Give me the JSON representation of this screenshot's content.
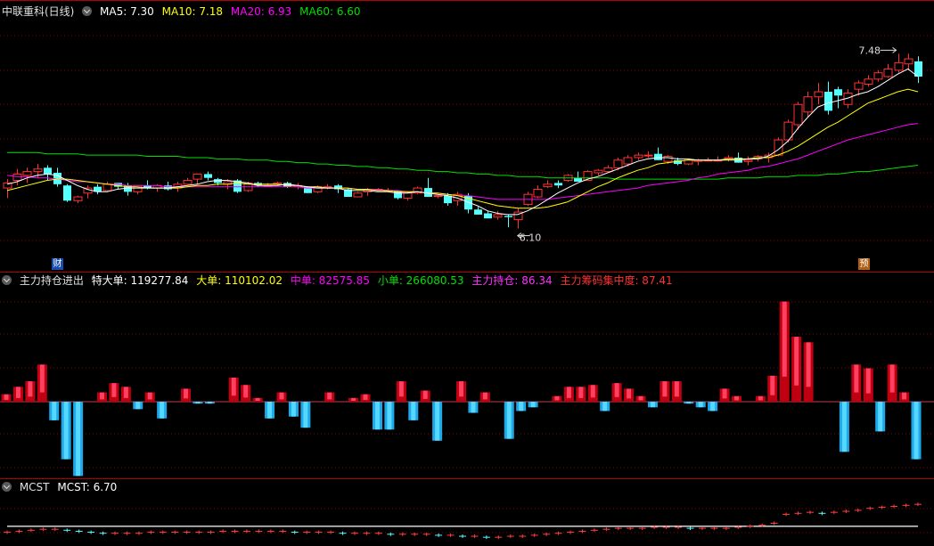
{
  "colors": {
    "up": "#ff3232",
    "down": "#54ffff",
    "ma5": "#ffffff",
    "ma10": "#ffff00",
    "ma20": "#ff00ff",
    "ma60": "#00e000",
    "grid": "#8b0000",
    "border": "#b00000",
    "bigbuy": "#b00000",
    "mcst_up": "#ff4040",
    "mcst_down": "#54ffff"
  },
  "price_panel": {
    "title": "中联重科(日线)",
    "ma5_label": "MA5: 7.30",
    "ma10_label": "MA10: 7.18",
    "ma20_label": "MA20: 6.93",
    "ma60_label": "MA60: 6.60",
    "high_label": "7.48",
    "low_label": "6.10",
    "badge_left": "财",
    "badge_right": "预"
  },
  "flow_panel": {
    "title": "主力持仓进出",
    "l1": "特大单: 119277.84",
    "l2": "大单: 110102.02",
    "l3": "中单: 82575.85",
    "l4": "小单: 266080.53",
    "l5": "主力持仓: 86.34",
    "l6": "主力筹码集中度: 87.41"
  },
  "mcst_panel": {
    "title": "MCST",
    "label": "MCST: 6.70"
  },
  "chart_data": [
    {
      "type": "candlestick",
      "title": "中联重科(日线)",
      "ylim": [
        5.9,
        7.75
      ],
      "annotations": {
        "high": 7.48,
        "low": 6.1
      },
      "ohlc": [
        [
          6.42,
          6.49,
          6.34,
          6.46
        ],
        [
          6.48,
          6.57,
          6.44,
          6.53
        ],
        [
          6.52,
          6.58,
          6.46,
          6.55
        ],
        [
          6.55,
          6.61,
          6.5,
          6.57
        ],
        [
          6.58,
          6.6,
          6.48,
          6.53
        ],
        [
          6.54,
          6.58,
          6.43,
          6.45
        ],
        [
          6.44,
          6.45,
          6.31,
          6.32
        ],
        [
          6.32,
          6.36,
          6.3,
          6.35
        ],
        [
          6.38,
          6.44,
          6.34,
          6.42
        ],
        [
          6.43,
          6.45,
          6.37,
          6.39
        ],
        [
          6.4,
          6.47,
          6.39,
          6.45
        ],
        [
          6.46,
          6.46,
          6.41,
          6.43
        ],
        [
          6.44,
          6.46,
          6.36,
          6.39
        ],
        [
          6.39,
          6.44,
          6.37,
          6.44
        ],
        [
          6.44,
          6.48,
          6.41,
          6.42
        ],
        [
          6.42,
          6.45,
          6.39,
          6.44
        ],
        [
          6.44,
          6.47,
          6.4,
          6.41
        ],
        [
          6.42,
          6.47,
          6.39,
          6.45
        ],
        [
          6.45,
          6.5,
          6.45,
          6.48
        ],
        [
          6.49,
          6.53,
          6.45,
          6.53
        ],
        [
          6.53,
          6.55,
          6.48,
          6.5
        ],
        [
          6.49,
          6.5,
          6.44,
          6.46
        ],
        [
          6.45,
          6.49,
          6.41,
          6.47
        ],
        [
          6.48,
          6.49,
          6.38,
          6.39
        ],
        [
          6.4,
          6.47,
          6.39,
          6.46
        ],
        [
          6.46,
          6.47,
          6.43,
          6.44
        ],
        [
          6.44,
          6.46,
          6.43,
          6.44
        ],
        [
          6.45,
          6.47,
          6.44,
          6.46
        ],
        [
          6.46,
          6.47,
          6.42,
          6.43
        ],
        [
          6.43,
          6.46,
          6.41,
          6.44
        ],
        [
          6.43,
          6.43,
          6.38,
          6.38
        ],
        [
          6.39,
          6.44,
          6.38,
          6.43
        ],
        [
          6.43,
          6.45,
          6.41,
          6.43
        ],
        [
          6.44,
          6.45,
          6.38,
          6.41
        ],
        [
          6.41,
          6.42,
          6.35,
          6.35
        ],
        [
          6.35,
          6.39,
          6.35,
          6.38
        ],
        [
          6.39,
          6.42,
          6.36,
          6.41
        ],
        [
          6.41,
          6.42,
          6.4,
          6.41
        ],
        [
          6.4,
          6.42,
          6.39,
          6.4
        ],
        [
          6.4,
          6.4,
          6.33,
          6.34
        ],
        [
          6.34,
          6.39,
          6.32,
          6.38
        ],
        [
          6.38,
          6.43,
          6.37,
          6.42
        ],
        [
          6.42,
          6.5,
          6.35,
          6.35
        ],
        [
          6.36,
          6.37,
          6.34,
          6.36
        ],
        [
          6.36,
          6.38,
          6.28,
          6.3
        ],
        [
          6.32,
          6.39,
          6.28,
          6.37
        ],
        [
          6.36,
          6.38,
          6.22,
          6.25
        ],
        [
          6.25,
          6.27,
          6.21,
          6.21
        ],
        [
          6.22,
          6.24,
          6.18,
          6.18
        ],
        [
          6.19,
          6.24,
          6.17,
          6.21
        ],
        [
          6.2,
          6.21,
          6.11,
          6.19
        ],
        [
          6.17,
          6.26,
          6.1,
          6.23
        ],
        [
          6.29,
          6.39,
          6.28,
          6.37
        ],
        [
          6.35,
          6.44,
          6.34,
          6.41
        ],
        [
          6.43,
          6.48,
          6.42,
          6.45
        ],
        [
          6.46,
          6.48,
          6.42,
          6.44
        ],
        [
          6.48,
          6.53,
          6.47,
          6.52
        ],
        [
          6.5,
          6.55,
          6.47,
          6.47
        ],
        [
          6.48,
          6.56,
          6.48,
          6.55
        ],
        [
          6.54,
          6.57,
          6.52,
          6.56
        ],
        [
          6.55,
          6.6,
          6.54,
          6.58
        ],
        [
          6.58,
          6.66,
          6.56,
          6.64
        ],
        [
          6.61,
          6.68,
          6.59,
          6.66
        ],
        [
          6.66,
          6.7,
          6.64,
          6.68
        ],
        [
          6.68,
          6.71,
          6.66,
          6.68
        ],
        [
          6.69,
          6.74,
          6.64,
          6.64
        ],
        [
          6.63,
          6.68,
          6.61,
          6.67
        ],
        [
          6.64,
          6.66,
          6.6,
          6.61
        ],
        [
          6.61,
          6.65,
          6.6,
          6.64
        ],
        [
          6.63,
          6.65,
          6.6,
          6.64
        ],
        [
          6.64,
          6.66,
          6.64,
          6.64
        ],
        [
          6.64,
          6.67,
          6.63,
          6.64
        ],
        [
          6.65,
          6.68,
          6.63,
          6.66
        ],
        [
          6.66,
          6.7,
          6.62,
          6.62
        ],
        [
          6.63,
          6.67,
          6.6,
          6.64
        ],
        [
          6.65,
          6.68,
          6.63,
          6.67
        ],
        [
          6.66,
          6.7,
          6.62,
          6.68
        ],
        [
          6.68,
          6.82,
          6.67,
          6.8
        ],
        [
          6.8,
          6.96,
          6.78,
          6.94
        ],
        [
          6.92,
          7.1,
          6.88,
          7.08
        ],
        [
          7.02,
          7.18,
          6.98,
          7.14
        ],
        [
          7.14,
          7.25,
          7.08,
          7.18
        ],
        [
          7.18,
          7.26,
          7.0,
          7.03
        ],
        [
          7.2,
          7.22,
          7.05,
          7.15
        ],
        [
          7.08,
          7.2,
          7.05,
          7.17
        ],
        [
          7.2,
          7.27,
          7.15,
          7.25
        ],
        [
          7.24,
          7.31,
          7.22,
          7.28
        ],
        [
          7.28,
          7.35,
          7.26,
          7.33
        ],
        [
          7.3,
          7.4,
          7.29,
          7.36
        ],
        [
          7.35,
          7.48,
          7.33,
          7.41
        ],
        [
          7.4,
          7.48,
          7.35,
          7.44
        ],
        [
          7.42,
          7.46,
          7.25,
          7.3
        ]
      ],
      "ma5": [
        6.45,
        6.47,
        6.5,
        6.52,
        6.53,
        6.52,
        6.48,
        6.44,
        6.41,
        6.39,
        6.39,
        6.41,
        6.42,
        6.42,
        6.42,
        6.42,
        6.42,
        6.43,
        6.44,
        6.45,
        6.47,
        6.48,
        6.48,
        6.47,
        6.46,
        6.44,
        6.44,
        6.44,
        6.45,
        6.44,
        6.43,
        6.42,
        6.42,
        6.42,
        6.4,
        6.4,
        6.4,
        6.39,
        6.39,
        6.38,
        6.38,
        6.39,
        6.38,
        6.37,
        6.36,
        6.34,
        6.31,
        6.28,
        6.24,
        6.22,
        6.21,
        6.21,
        6.24,
        6.28,
        6.33,
        6.38,
        6.42,
        6.46,
        6.49,
        6.51,
        6.54,
        6.57,
        6.6,
        6.63,
        6.65,
        6.66,
        6.66,
        6.65,
        6.65,
        6.64,
        6.64,
        6.64,
        6.64,
        6.64,
        6.65,
        6.65,
        6.67,
        6.72,
        6.79,
        6.89,
        6.98,
        7.06,
        7.09,
        7.11,
        7.13,
        7.16,
        7.18,
        7.22,
        7.27,
        7.32,
        7.36,
        7.3
      ],
      "ma10": [
        6.4,
        6.42,
        6.44,
        6.46,
        6.48,
        6.49,
        6.49,
        6.48,
        6.47,
        6.46,
        6.45,
        6.44,
        6.43,
        6.43,
        6.42,
        6.42,
        6.42,
        6.42,
        6.43,
        6.44,
        6.44,
        6.45,
        6.45,
        6.46,
        6.45,
        6.45,
        6.45,
        6.45,
        6.44,
        6.44,
        6.43,
        6.43,
        6.42,
        6.42,
        6.42,
        6.41,
        6.41,
        6.4,
        6.4,
        6.39,
        6.39,
        6.39,
        6.38,
        6.38,
        6.37,
        6.36,
        6.34,
        6.32,
        6.3,
        6.28,
        6.27,
        6.26,
        6.26,
        6.26,
        6.27,
        6.29,
        6.31,
        6.35,
        6.39,
        6.43,
        6.46,
        6.5,
        6.53,
        6.56,
        6.58,
        6.61,
        6.62,
        6.63,
        6.64,
        6.64,
        6.64,
        6.64,
        6.65,
        6.65,
        6.65,
        6.66,
        6.66,
        6.68,
        6.71,
        6.75,
        6.8,
        6.85,
        6.9,
        6.94,
        6.99,
        7.04,
        7.09,
        7.12,
        7.15,
        7.18,
        7.2,
        7.18
      ],
      "ma20": [
        6.52,
        6.51,
        6.51,
        6.5,
        6.5,
        6.49,
        6.48,
        6.47,
        6.47,
        6.46,
        6.45,
        6.45,
        6.44,
        6.44,
        6.44,
        6.44,
        6.43,
        6.43,
        6.43,
        6.43,
        6.43,
        6.43,
        6.43,
        6.43,
        6.43,
        6.43,
        6.43,
        6.43,
        6.43,
        6.43,
        6.42,
        6.42,
        6.42,
        6.42,
        6.42,
        6.41,
        6.41,
        6.41,
        6.4,
        6.4,
        6.39,
        6.39,
        6.38,
        6.38,
        6.37,
        6.36,
        6.36,
        6.35,
        6.34,
        6.33,
        6.33,
        6.33,
        6.33,
        6.33,
        6.33,
        6.34,
        6.35,
        6.36,
        6.37,
        6.38,
        6.39,
        6.4,
        6.41,
        6.42,
        6.44,
        6.45,
        6.46,
        6.47,
        6.48,
        6.5,
        6.51,
        6.53,
        6.54,
        6.55,
        6.56,
        6.58,
        6.59,
        6.61,
        6.63,
        6.65,
        6.68,
        6.71,
        6.74,
        6.77,
        6.8,
        6.82,
        6.84,
        6.86,
        6.88,
        6.9,
        6.92,
        6.93
      ],
      "ma60": [
        6.7,
        6.7,
        6.7,
        6.7,
        6.69,
        6.69,
        6.69,
        6.69,
        6.68,
        6.68,
        6.68,
        6.68,
        6.68,
        6.68,
        6.67,
        6.67,
        6.67,
        6.67,
        6.66,
        6.66,
        6.66,
        6.65,
        6.65,
        6.65,
        6.64,
        6.64,
        6.64,
        6.63,
        6.63,
        6.62,
        6.62,
        6.61,
        6.61,
        6.6,
        6.6,
        6.59,
        6.59,
        6.58,
        6.58,
        6.57,
        6.57,
        6.56,
        6.56,
        6.55,
        6.55,
        6.54,
        6.54,
        6.53,
        6.53,
        6.52,
        6.52,
        6.51,
        6.51,
        6.51,
        6.5,
        6.5,
        6.5,
        6.5,
        6.5,
        6.5,
        6.5,
        6.49,
        6.49,
        6.49,
        6.49,
        6.49,
        6.49,
        6.49,
        6.49,
        6.49,
        6.49,
        6.49,
        6.5,
        6.5,
        6.5,
        6.5,
        6.51,
        6.51,
        6.51,
        6.52,
        6.52,
        6.52,
        6.53,
        6.53,
        6.54,
        6.55,
        6.55,
        6.56,
        6.57,
        6.58,
        6.59,
        6.6
      ]
    },
    {
      "type": "bar",
      "title": "主力持仓进出",
      "ylim": [
        -40000,
        60000
      ],
      "values": [
        4000,
        8000,
        11000,
        20000,
        -10000,
        -31000,
        -40000,
        0,
        5000,
        10000,
        8000,
        -4000,
        5000,
        -9000,
        0,
        7000,
        -1000,
        -1000,
        0,
        13000,
        9000,
        2000,
        -9000,
        5000,
        -8000,
        -14000,
        0,
        5000,
        0,
        2000,
        4000,
        -15000,
        -15000,
        11000,
        -10000,
        6000,
        -21000,
        0,
        11000,
        -6000,
        5000,
        0,
        -20000,
        -5000,
        -3000,
        0,
        3000,
        8000,
        8000,
        9000,
        -5000,
        10000,
        7000,
        3000,
        -3000,
        11000,
        11000,
        -1000,
        -3000,
        -5000,
        7000,
        3000,
        0,
        3000,
        14000,
        54000,
        35000,
        32000,
        0,
        0,
        -27000,
        20000,
        18000,
        -16000,
        20000,
        5000,
        -31000
      ],
      "series_labels": [
        "特大单",
        "大单",
        "中单",
        "小单",
        "主力持仓",
        "主力筹码集中度"
      ]
    },
    {
      "type": "line",
      "title": "MCST",
      "ylim": [
        6.3,
        6.8
      ],
      "values": [
        6.42,
        6.43,
        6.44,
        6.45,
        6.45,
        6.44,
        6.43,
        6.42,
        6.41,
        6.41,
        6.41,
        6.41,
        6.42,
        6.42,
        6.42,
        6.42,
        6.42,
        6.42,
        6.43,
        6.43,
        6.43,
        6.43,
        6.43,
        6.43,
        6.42,
        6.42,
        6.42,
        6.42,
        6.41,
        6.41,
        6.41,
        6.41,
        6.4,
        6.4,
        6.4,
        6.4,
        6.39,
        6.39,
        6.38,
        6.38,
        6.37,
        6.37,
        6.38,
        6.38,
        6.39,
        6.4,
        6.41,
        6.42,
        6.43,
        6.44,
        6.45,
        6.46,
        6.46,
        6.46,
        6.47,
        6.47,
        6.47,
        6.46,
        6.46,
        6.46,
        6.46,
        6.47,
        6.48,
        6.49,
        6.51,
        6.6,
        6.61,
        6.62,
        6.61,
        6.62,
        6.63,
        6.64,
        6.66,
        6.67,
        6.68,
        6.69,
        6.7
      ],
      "cost_line": 6.48
    }
  ]
}
